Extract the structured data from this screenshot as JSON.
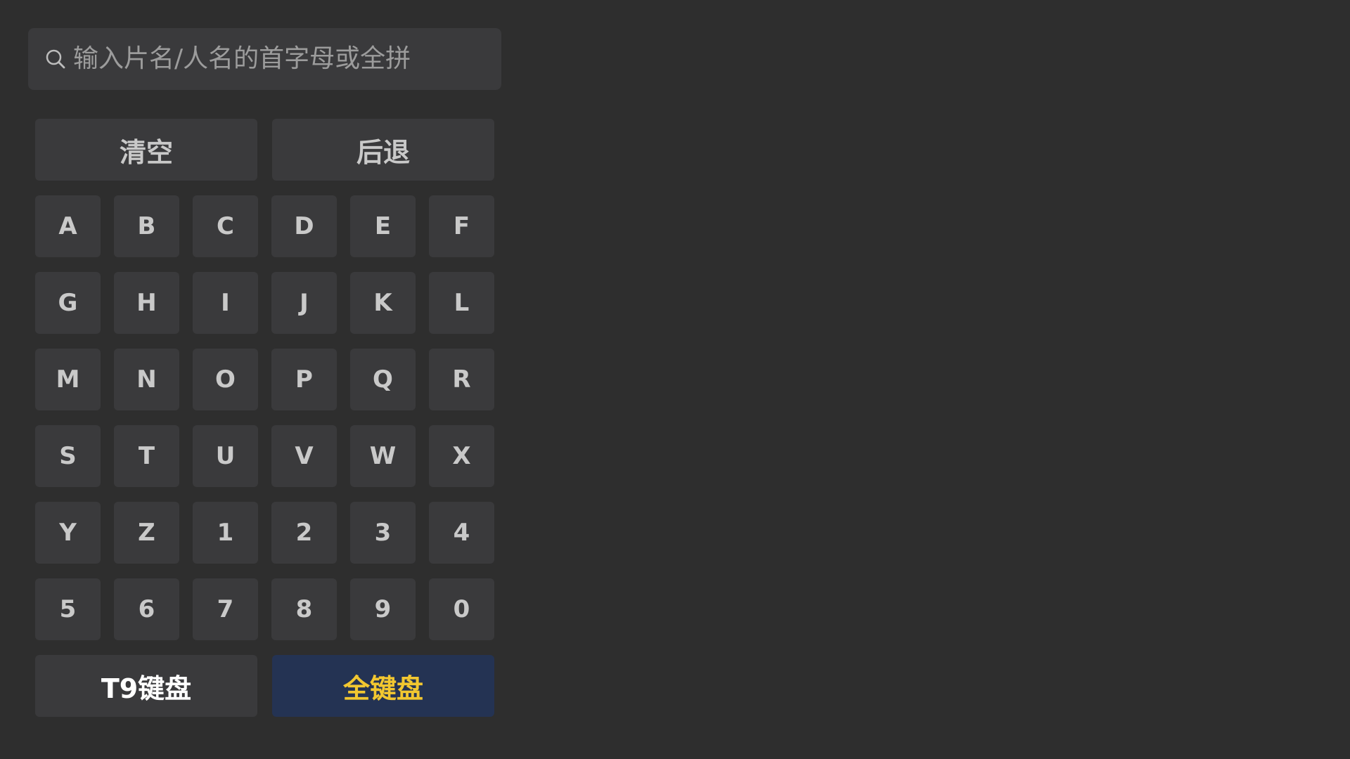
{
  "search": {
    "placeholder": "输入片名/人名的首字母或全拼",
    "icon": "search-icon"
  },
  "actions": {
    "clear_label": "清空",
    "backspace_label": "后退"
  },
  "keys": [
    [
      "A",
      "B",
      "C",
      "D",
      "E",
      "F"
    ],
    [
      "G",
      "H",
      "I",
      "J",
      "K",
      "L"
    ],
    [
      "M",
      "N",
      "O",
      "P",
      "Q",
      "R"
    ],
    [
      "S",
      "T",
      "U",
      "V",
      "W",
      "X"
    ],
    [
      "Y",
      "Z",
      "1",
      "2",
      "3",
      "4"
    ],
    [
      "5",
      "6",
      "7",
      "8",
      "9",
      "0"
    ]
  ],
  "keyboard_modes": {
    "t9_label": "T9键盘",
    "full_label": "全键盘",
    "selected": "全键盘"
  },
  "colors": {
    "background": "#2e2e2e",
    "key_background": "#3a3a3c",
    "selected_background": "#243353",
    "selected_text": "#f2c730",
    "key_text": "#c9c9c9"
  }
}
